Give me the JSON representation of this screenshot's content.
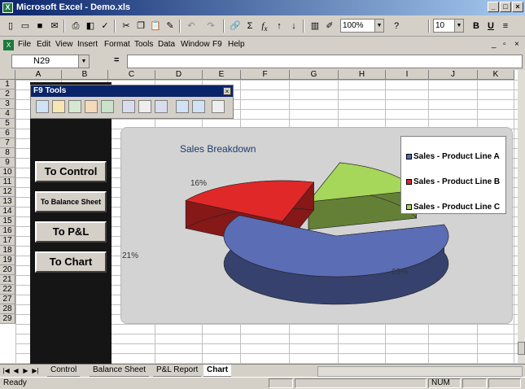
{
  "window": {
    "title": "Microsoft Excel - Demo.xls",
    "app_icon": "excel-icon"
  },
  "toolbar": {
    "zoom": "100%",
    "font_size": "10",
    "bold": "B",
    "underline": "U",
    "sum": "Σ",
    "fx": "f",
    "fx_sub": "x"
  },
  "menu": {
    "items": [
      "File",
      "Edit",
      "View",
      "Insert",
      "Format",
      "Tools",
      "Data",
      "Window",
      "F9",
      "Help"
    ]
  },
  "formula_bar": {
    "name_box": "N29",
    "equals": "="
  },
  "columns": [
    "A",
    "B",
    "C",
    "D",
    "E",
    "F",
    "G",
    "H",
    "I",
    "J",
    "K"
  ],
  "rows": [
    "1",
    "2",
    "3",
    "4",
    "5",
    "6",
    "7",
    "8",
    "9",
    "10",
    "11",
    "12",
    "13",
    "14",
    "15",
    "16",
    "17",
    "18",
    "19",
    "20",
    "21",
    "22",
    "27",
    "28",
    "29"
  ],
  "f9_tools": {
    "title": "F9 Tools",
    "close": "×"
  },
  "nav_buttons": {
    "control": "To Control",
    "balance_sheet": "To Balance Sheet",
    "pnl": "To P&L",
    "chart": "To Chart"
  },
  "chart_data": {
    "type": "pie",
    "title": "Sales Breakdown",
    "categories": [
      "Sales - Product Line A",
      "Sales - Product Line B",
      "Sales - Product Line C"
    ],
    "values": [
      63,
      21,
      16
    ],
    "labels": [
      "63%",
      "21%",
      "16%"
    ],
    "colors": [
      "#5b6db5",
      "#e02828",
      "#a6d65a"
    ],
    "legend_position": "right",
    "style": "3d-exploded"
  },
  "sheet_tabs": [
    {
      "label": "Control",
      "active": false
    },
    {
      "label": "Balance Sheet",
      "active": false
    },
    {
      "label": "P&L Report",
      "active": false
    },
    {
      "label": "Chart",
      "active": true
    }
  ],
  "status": {
    "text": "Ready",
    "num": "NUM"
  }
}
